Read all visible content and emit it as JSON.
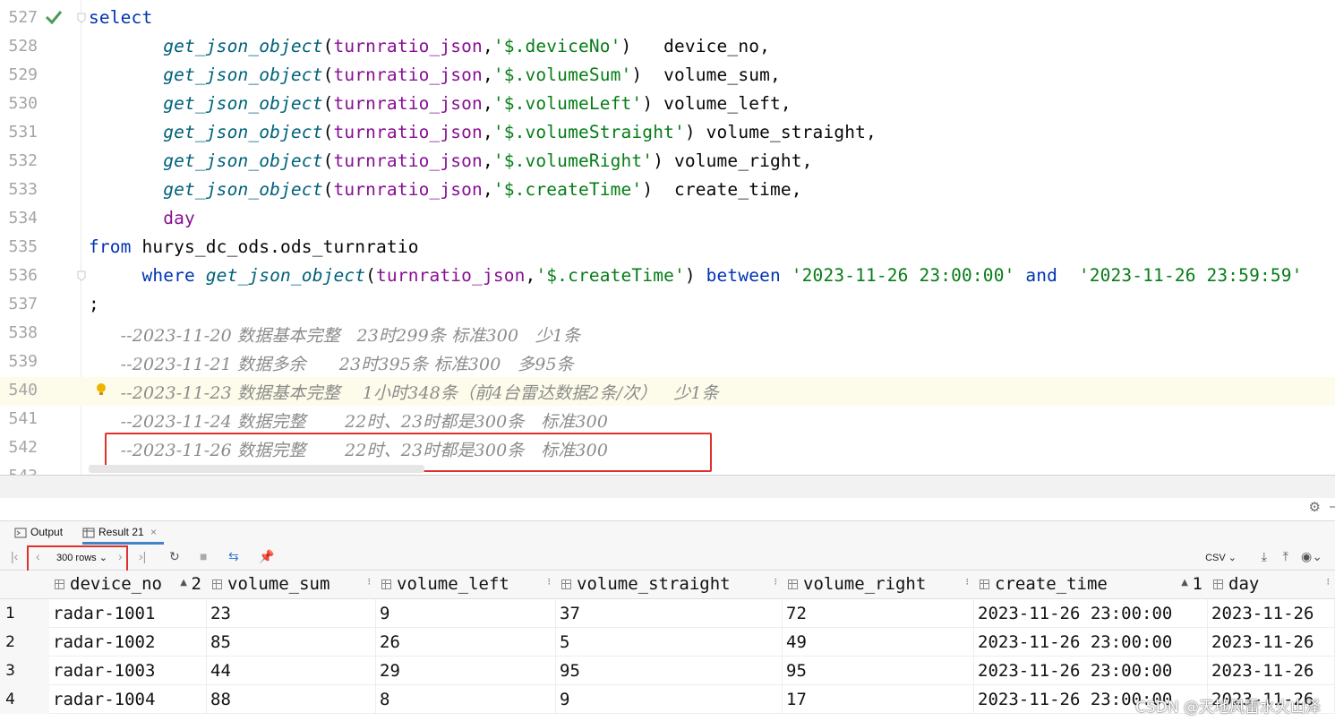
{
  "editor": {
    "lines": [
      {
        "num": "527",
        "tokens": [
          {
            "c": "kw",
            "t": "select"
          }
        ]
      },
      {
        "num": "528",
        "tokens": [
          {
            "c": "id",
            "t": "       "
          },
          {
            "c": "fn",
            "t": "get_json_object"
          },
          {
            "c": "id",
            "t": "("
          },
          {
            "c": "kw2",
            "t": "turnratio_json"
          },
          {
            "c": "id",
            "t": ","
          },
          {
            "c": "str",
            "t": "'$.deviceNo'"
          },
          {
            "c": "id",
            "t": ")   device_no,"
          }
        ]
      },
      {
        "num": "529",
        "tokens": [
          {
            "c": "id",
            "t": "       "
          },
          {
            "c": "fn",
            "t": "get_json_object"
          },
          {
            "c": "id",
            "t": "("
          },
          {
            "c": "kw2",
            "t": "turnratio_json"
          },
          {
            "c": "id",
            "t": ","
          },
          {
            "c": "str",
            "t": "'$.volumeSum'"
          },
          {
            "c": "id",
            "t": ")  volume_sum,"
          }
        ]
      },
      {
        "num": "530",
        "tokens": [
          {
            "c": "id",
            "t": "       "
          },
          {
            "c": "fn",
            "t": "get_json_object"
          },
          {
            "c": "id",
            "t": "("
          },
          {
            "c": "kw2",
            "t": "turnratio_json"
          },
          {
            "c": "id",
            "t": ","
          },
          {
            "c": "str",
            "t": "'$.volumeLeft'"
          },
          {
            "c": "id",
            "t": ") volume_left,"
          }
        ]
      },
      {
        "num": "531",
        "tokens": [
          {
            "c": "id",
            "t": "       "
          },
          {
            "c": "fn",
            "t": "get_json_object"
          },
          {
            "c": "id",
            "t": "("
          },
          {
            "c": "kw2",
            "t": "turnratio_json"
          },
          {
            "c": "id",
            "t": ","
          },
          {
            "c": "str",
            "t": "'$.volumeStraight'"
          },
          {
            "c": "id",
            "t": ") volume_straight,"
          }
        ]
      },
      {
        "num": "532",
        "tokens": [
          {
            "c": "id",
            "t": "       "
          },
          {
            "c": "fn",
            "t": "get_json_object"
          },
          {
            "c": "id",
            "t": "("
          },
          {
            "c": "kw2",
            "t": "turnratio_json"
          },
          {
            "c": "id",
            "t": ","
          },
          {
            "c": "str",
            "t": "'$.volumeRight'"
          },
          {
            "c": "id",
            "t": ") volume_right,"
          }
        ]
      },
      {
        "num": "533",
        "tokens": [
          {
            "c": "id",
            "t": "       "
          },
          {
            "c": "fn",
            "t": "get_json_object"
          },
          {
            "c": "id",
            "t": "("
          },
          {
            "c": "kw2",
            "t": "turnratio_json"
          },
          {
            "c": "id",
            "t": ","
          },
          {
            "c": "str",
            "t": "'$.createTime'"
          },
          {
            "c": "id",
            "t": ")  create_time,"
          }
        ]
      },
      {
        "num": "534",
        "tokens": [
          {
            "c": "id",
            "t": "       "
          },
          {
            "c": "kw2",
            "t": "day"
          }
        ]
      },
      {
        "num": "535",
        "tokens": [
          {
            "c": "kw",
            "t": "from"
          },
          {
            "c": "id",
            "t": " hurys_dc_ods.ods_turnratio"
          }
        ]
      },
      {
        "num": "536",
        "tokens": [
          {
            "c": "id",
            "t": "     "
          },
          {
            "c": "kw",
            "t": "where"
          },
          {
            "c": "id",
            "t": " "
          },
          {
            "c": "fn",
            "t": "get_json_object"
          },
          {
            "c": "id",
            "t": "("
          },
          {
            "c": "kw2",
            "t": "turnratio_json"
          },
          {
            "c": "id",
            "t": ","
          },
          {
            "c": "str",
            "t": "'$.createTime'"
          },
          {
            "c": "id",
            "t": ") "
          },
          {
            "c": "kw",
            "t": "between"
          },
          {
            "c": "id",
            "t": " "
          },
          {
            "c": "str",
            "t": "'2023-11-26 23:00:00'"
          },
          {
            "c": "id",
            "t": " "
          },
          {
            "c": "kw",
            "t": "and"
          },
          {
            "c": "id",
            "t": "  "
          },
          {
            "c": "str",
            "t": "'2023-11-26 23:59:59'"
          }
        ]
      },
      {
        "num": "537",
        "tokens": [
          {
            "c": "id",
            "t": ";"
          }
        ]
      },
      {
        "num": "538",
        "tokens": [
          {
            "c": "id",
            "t": "   "
          },
          {
            "c": "cmt",
            "t": "--2023-11-20 数据基本完整   23时299条 标准300   少1条"
          }
        ]
      },
      {
        "num": "539",
        "tokens": [
          {
            "c": "id",
            "t": "   "
          },
          {
            "c": "cmt",
            "t": "--2023-11-21 数据多余      23时395条 标准300   多95条"
          }
        ]
      },
      {
        "num": "540",
        "tokens": [
          {
            "c": "id",
            "t": "   "
          },
          {
            "c": "cmt",
            "t": "--2023-11-23 数据基本完整    1小时348条（前4台雷达数据2条/次）   少1条"
          }
        ]
      },
      {
        "num": "541",
        "tokens": [
          {
            "c": "id",
            "t": "   "
          },
          {
            "c": "cmt",
            "t": "--2023-11-24 数据完整       22时、23时都是300条   标准300"
          }
        ]
      },
      {
        "num": "542",
        "tokens": [
          {
            "c": "id",
            "t": "   "
          },
          {
            "c": "cmt",
            "t": "--2023-11-26 数据完整       22时、23时都是300条   标准300"
          }
        ]
      },
      {
        "num": "543",
        "tokens": []
      }
    ]
  },
  "tabs": {
    "output": "Output",
    "result": "Result 21"
  },
  "toolbar": {
    "rows": "300 rows",
    "export_format": "CSV"
  },
  "grid": {
    "columns": [
      {
        "label": "device_no",
        "sort": "2",
        "dir": "▲"
      },
      {
        "label": "volume_sum",
        "sort": "",
        "dir": ""
      },
      {
        "label": "volume_left",
        "sort": "",
        "dir": ""
      },
      {
        "label": "volume_straight",
        "sort": "",
        "dir": ""
      },
      {
        "label": "volume_right",
        "sort": "",
        "dir": ""
      },
      {
        "label": "create_time",
        "sort": "1",
        "dir": "▲"
      },
      {
        "label": "day",
        "sort": "",
        "dir": ""
      }
    ],
    "rows": [
      {
        "n": "1",
        "cells": [
          "radar-1001",
          "23",
          "9",
          "37",
          "72",
          "2023-11-26 23:00:00",
          "2023-11-26"
        ]
      },
      {
        "n": "2",
        "cells": [
          "radar-1002",
          "85",
          "26",
          "5",
          "49",
          "2023-11-26 23:00:00",
          "2023-11-26"
        ]
      },
      {
        "n": "3",
        "cells": [
          "radar-1003",
          "44",
          "29",
          "95",
          "95",
          "2023-11-26 23:00:00",
          "2023-11-26"
        ]
      },
      {
        "n": "4",
        "cells": [
          "radar-1004",
          "88",
          "8",
          "9",
          "17",
          "2023-11-26 23:00:00",
          "2023-11-26"
        ]
      }
    ]
  },
  "watermark": "CSDN @天地风雷水火山泽",
  "colors": {
    "keyword": "#0033b3",
    "identifier_purple": "#871094",
    "function": "#00627a",
    "string": "#067d17",
    "comment": "#8c8c8c",
    "highlight_box": "#e0302b"
  }
}
